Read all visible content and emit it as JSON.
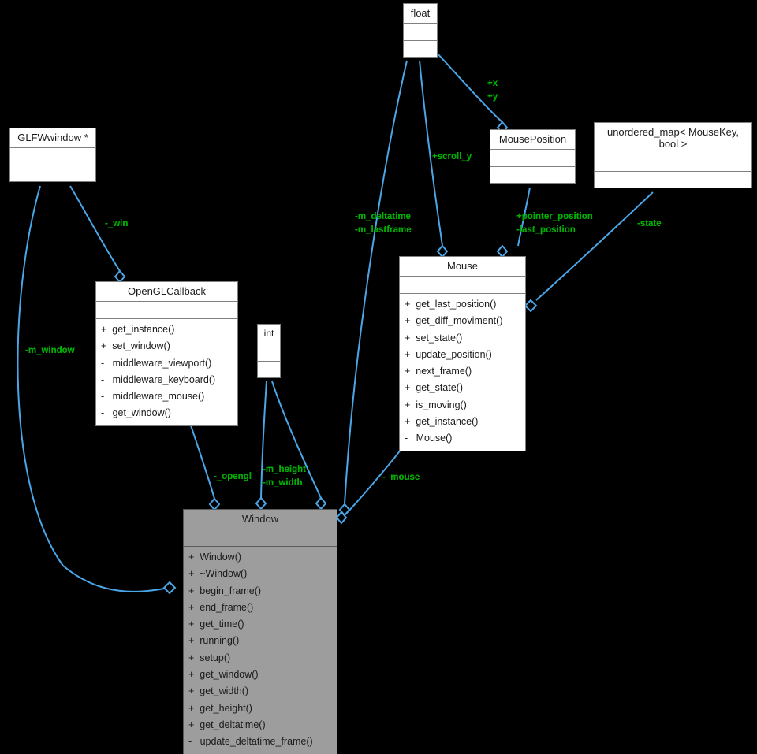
{
  "diagram": {
    "title": "Window class collaboration diagram",
    "background_color": "#000000",
    "edge_color": "#4ba6e8",
    "label_color": "#00b000",
    "node_fill": "#ffffff",
    "node_selected_fill": "#9d9d9d",
    "node_border": "#808080"
  },
  "nodes": {
    "float": {
      "title": "float",
      "attributes": [],
      "operations": []
    },
    "glfwwindow": {
      "title": "GLFWwindow *",
      "attributes": [],
      "operations": []
    },
    "mouseposition": {
      "title": "MousePosition",
      "attributes": [],
      "operations": []
    },
    "unordered_map": {
      "title": "unordered_map< MouseKey,\nbool >",
      "attributes": [],
      "operations": []
    },
    "opengl_callback": {
      "title": "OpenGLCallback",
      "attributes": [],
      "operations": [
        "+  get_instance()",
        "+  set_window()",
        "-   middleware_viewport()",
        "-   middleware_keyboard()",
        "-   middleware_mouse()",
        "-   get_window()"
      ]
    },
    "int": {
      "title": "int",
      "attributes": [],
      "operations": []
    },
    "mouse": {
      "title": "Mouse",
      "attributes": [],
      "operations": [
        "+  get_last_position()",
        "+  get_diff_moviment()",
        "+  set_state()",
        "+  update_position()",
        "+  next_frame()",
        "+  get_state()",
        "+  is_moving()",
        "+  get_instance()",
        "-   Mouse()"
      ]
    },
    "window": {
      "title": "Window",
      "attributes": [],
      "operations": [
        "+  Window()",
        "+  ~Window()",
        "+  begin_frame()",
        "+  end_frame()",
        "+  get_time()",
        "+  running()",
        "+  setup()",
        "+  get_window()",
        "+  get_width()",
        "+  get_height()",
        "+  get_deltatime()",
        "-   update_deltatime_frame()"
      ]
    }
  },
  "edge_labels": {
    "x_y": "+x\n+y",
    "scroll_y": "+scroll_y",
    "deltatime": "-m_deltatime\n-m_lastframe",
    "pointer_position": "+pointer_position\n-last_position",
    "state": "-state",
    "win": "-_win",
    "m_window": "-m_window",
    "opengl": "-_opengl",
    "height_width": "-m_height\n-m_width",
    "mouse": "-_mouse"
  }
}
